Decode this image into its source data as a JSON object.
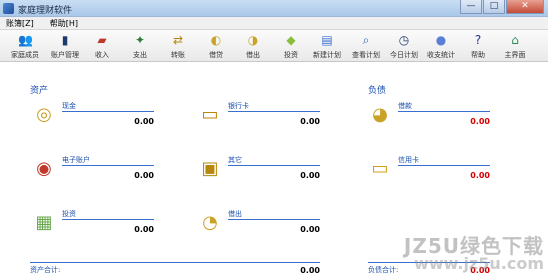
{
  "window": {
    "title": "家庭理财软件",
    "controls": [
      "—",
      "□",
      "✕"
    ]
  },
  "menu": [
    "账簿[Z]",
    "帮助[H]"
  ],
  "toolbar": [
    {
      "label": "家庭成员",
      "icon": "family-icon",
      "glyph": "👥",
      "color": "#3a6fcf"
    },
    {
      "label": "账户管理",
      "icon": "account-icon",
      "glyph": "▮",
      "color": "#1d3a6e"
    },
    {
      "label": "收入",
      "icon": "wallet-in-icon",
      "glyph": "▰",
      "color": "#c0392b"
    },
    {
      "label": "支出",
      "icon": "money-out-icon",
      "glyph": "✦",
      "color": "#2e7d32"
    },
    {
      "label": "转账",
      "icon": "transfer-icon",
      "glyph": "⇄",
      "color": "#b8860b"
    },
    {
      "label": "借贷",
      "icon": "loan-icon",
      "glyph": "◐",
      "color": "#c9a227"
    },
    {
      "label": "借出",
      "icon": "lend-icon",
      "glyph": "◑",
      "color": "#c9a227"
    },
    {
      "label": "投资",
      "icon": "invest-icon",
      "glyph": "◆",
      "color": "#8bbd3c"
    },
    {
      "label": "新建计划",
      "icon": "new-plan-icon",
      "glyph": "▤",
      "color": "#3a6fcf"
    },
    {
      "label": "查看计划",
      "icon": "view-plan-icon",
      "glyph": "⌕",
      "color": "#2b6cb0"
    },
    {
      "label": "今日计划",
      "icon": "today-plan-icon",
      "glyph": "◷",
      "color": "#1d3a6e"
    },
    {
      "label": "收支统计",
      "icon": "statistics-icon",
      "glyph": "●",
      "color": "#5a7fd6"
    },
    {
      "label": "帮助",
      "icon": "help-icon",
      "glyph": "?",
      "color": "#1d3a8a"
    },
    {
      "label": "主界面",
      "icon": "home-icon",
      "glyph": "⌂",
      "color": "#2e8b57"
    }
  ],
  "assets": {
    "title": "资产",
    "items": [
      {
        "name": "现金",
        "amount": "0.00",
        "icon": "coins-icon",
        "glyph": "◎",
        "color": "#c9a227"
      },
      {
        "name": "银行卡",
        "amount": "0.00",
        "icon": "bank-card-icon",
        "glyph": "▭",
        "color": "#b8860b"
      },
      {
        "name": "电子账户",
        "amount": "0.00",
        "icon": "e-account-icon",
        "glyph": "◉",
        "color": "#c0392b"
      },
      {
        "name": "其它",
        "amount": "0.00",
        "icon": "other-icon",
        "glyph": "▣",
        "color": "#b8860b"
      },
      {
        "name": "投资",
        "amount": "0.00",
        "icon": "investment-cash-icon",
        "glyph": "▦",
        "color": "#6aa84f"
      },
      {
        "name": "借出",
        "amount": "0.00",
        "icon": "lent-out-icon",
        "glyph": "◔",
        "color": "#c9a227"
      }
    ],
    "total_label": "资产合计:",
    "total": "0.00"
  },
  "liabilities": {
    "title": "负债",
    "items": [
      {
        "name": "借款",
        "amount": "0.00",
        "icon": "borrow-icon",
        "glyph": "◕",
        "color": "#c9a227"
      },
      {
        "name": "信用卡",
        "amount": "0.00",
        "icon": "credit-card-icon",
        "glyph": "▭",
        "color": "#d4a017"
      }
    ],
    "total_label": "负债合计:",
    "total": "0.00"
  },
  "watermark": {
    "line1": "JZ5U绿色下载",
    "line2": "www.jz5u.com"
  }
}
